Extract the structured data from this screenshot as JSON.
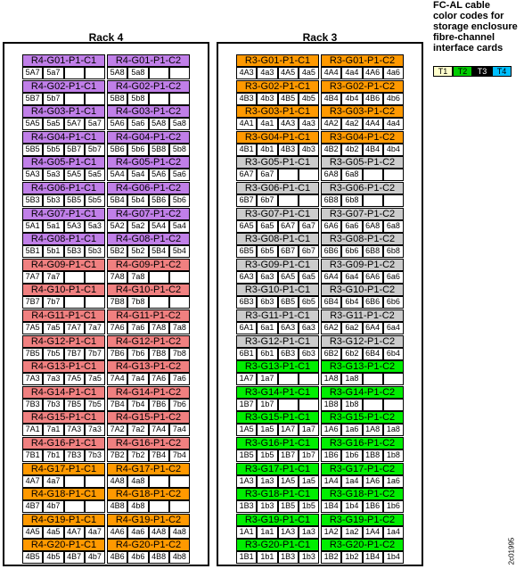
{
  "legend": {
    "title_lines": [
      "FC-AL cable",
      "color codes for",
      "storage enclosure",
      "fibre-channel",
      "interface cards"
    ],
    "items": [
      {
        "label": "T1",
        "color": "#ffffcc",
        "text_color": "#000000"
      },
      {
        "label": "T2",
        "color": "#00cc00",
        "text_color": "#000000"
      },
      {
        "label": "T3",
        "color": "#000000",
        "text_color": "#ffffff"
      },
      {
        "label": "T4",
        "color": "#00bfff",
        "text_color": "#000000"
      }
    ]
  },
  "figure_id": "2c01995",
  "racks": [
    {
      "title": "Rack 4",
      "slots": [
        {
          "c1": "R4-G01-P1-C1",
          "c2": "R4-G01-P1-C2",
          "color": "#c07fe8",
          "ports": [
            "5A7",
            "5a7",
            "",
            "",
            "5A8",
            "5a8",
            "",
            ""
          ]
        },
        {
          "c1": "R4-G02-P1-C1",
          "c2": "R4-G02-P1-C2",
          "color": "#c07fe8",
          "ports": [
            "5B7",
            "5b7",
            "",
            "",
            "5B8",
            "5b8",
            "",
            ""
          ]
        },
        {
          "c1": "R4-G03-P1-C1",
          "c2": "R4-G03-P1-C2",
          "color": "#c07fe8",
          "ports": [
            "5A5",
            "5a5",
            "5A7",
            "5a7",
            "5A6",
            "5a6",
            "5A8",
            "5a8"
          ]
        },
        {
          "c1": "R4-G04-P1-C1",
          "c2": "R4-G04-P1-C2",
          "color": "#c07fe8",
          "ports": [
            "5B5",
            "5b5",
            "5B7",
            "5b7",
            "5B6",
            "5b6",
            "5B8",
            "5b8"
          ]
        },
        {
          "c1": "R4-G05-P1-C1",
          "c2": "R4-G05-P1-C2",
          "color": "#c07fe8",
          "ports": [
            "5A3",
            "5a3",
            "5A5",
            "5a5",
            "5A4",
            "5a4",
            "5A6",
            "5a6"
          ]
        },
        {
          "c1": "R4-G06-P1-C1",
          "c2": "R4-G06-P1-C2",
          "color": "#c07fe8",
          "ports": [
            "5B3",
            "5b3",
            "5B5",
            "5b5",
            "5B4",
            "5b4",
            "5B6",
            "5b6"
          ]
        },
        {
          "c1": "R4-G07-P1-C1",
          "c2": "R4-G07-P1-C2",
          "color": "#c07fe8",
          "ports": [
            "5A1",
            "5a1",
            "5A3",
            "5a3",
            "5A2",
            "5a2",
            "5A4",
            "5a4"
          ]
        },
        {
          "c1": "R4-G08-P1-C1",
          "c2": "R4-G08-P1-C2",
          "color": "#c07fe8",
          "ports": [
            "5B1",
            "5b1",
            "5B3",
            "5b3",
            "5B2",
            "5b2",
            "5B4",
            "5b4"
          ]
        },
        {
          "c1": "R4-G09-P1-C1",
          "c2": "R4-G09-P1-C2",
          "color": "#f08080",
          "ports": [
            "7A7",
            "7a7",
            "",
            "",
            "7A8",
            "7a8",
            "",
            ""
          ]
        },
        {
          "c1": "R4-G10-P1-C1",
          "c2": "R4-G10-P1-C2",
          "color": "#f08080",
          "ports": [
            "7B7",
            "7b7",
            "",
            "",
            "7B8",
            "7b8",
            "",
            ""
          ]
        },
        {
          "c1": "R4-G11-P1-C1",
          "c2": "R4-G11-P1-C2",
          "color": "#f08080",
          "ports": [
            "7A5",
            "7a5",
            "7A7",
            "7a7",
            "7A6",
            "7a6",
            "7A8",
            "7a8"
          ]
        },
        {
          "c1": "R4-G12-P1-C1",
          "c2": "R4-G12-P1-C2",
          "color": "#f08080",
          "ports": [
            "7B5",
            "7b5",
            "7B7",
            "7b7",
            "7B6",
            "7b6",
            "7B8",
            "7b8"
          ]
        },
        {
          "c1": "R4-G13-P1-C1",
          "c2": "R4-G13-P1-C2",
          "color": "#f08080",
          "ports": [
            "7A3",
            "7a3",
            "7A5",
            "7a5",
            "7A4",
            "7a4",
            "7A6",
            "7a6"
          ]
        },
        {
          "c1": "R4-G14-P1-C1",
          "c2": "R4-G14-P1-C2",
          "color": "#f08080",
          "ports": [
            "7B3",
            "7b3",
            "7B5",
            "7b5",
            "7B4",
            "7b4",
            "7B6",
            "7b6"
          ]
        },
        {
          "c1": "R4-G15-P1-C1",
          "c2": "R4-G15-P1-C2",
          "color": "#f08080",
          "ports": [
            "7A1",
            "7a1",
            "7A3",
            "7a3",
            "7A2",
            "7a2",
            "7A4",
            "7a4"
          ]
        },
        {
          "c1": "R4-G16-P1-C1",
          "c2": "R4-G16-P1-C2",
          "color": "#f08080",
          "ports": [
            "7B1",
            "7b1",
            "7B3",
            "7b3",
            "7B2",
            "7b2",
            "7B4",
            "7b4"
          ]
        },
        {
          "c1": "R4-G17-P1-C1",
          "c2": "R4-G17-P1-C2",
          "color": "#ff9900",
          "ports": [
            "4A7",
            "4a7",
            "",
            "",
            "4A8",
            "4a8",
            "",
            ""
          ]
        },
        {
          "c1": "R4-G18-P1-C1",
          "c2": "R4-G18-P1-C2",
          "color": "#ff9900",
          "ports": [
            "4B7",
            "4b7",
            "",
            "",
            "4B8",
            "4b8",
            "",
            ""
          ]
        },
        {
          "c1": "R4-G19-P1-C1",
          "c2": "R4-G19-P1-C2",
          "color": "#ff9900",
          "ports": [
            "4A5",
            "4a5",
            "4A7",
            "4a7",
            "4A6",
            "4a6",
            "4A8",
            "4a8"
          ]
        },
        {
          "c1": "R4-G20-P1-C1",
          "c2": "R4-G20-P1-C2",
          "color": "#ff9900",
          "ports": [
            "4B5",
            "4b5",
            "4B7",
            "4b7",
            "4B6",
            "4b6",
            "4B8",
            "4b8"
          ]
        }
      ]
    },
    {
      "title": "Rack 3",
      "slots": [
        {
          "c1": "R3-G01-P1-C1",
          "c2": "R3-G01-P1-C2",
          "color": "#ff9900",
          "ports": [
            "4A3",
            "4a3",
            "4A5",
            "4a5",
            "4A4",
            "4a4",
            "4A6",
            "4a6"
          ]
        },
        {
          "c1": "R3-G02-P1-C1",
          "c2": "R3-G02-P1-C2",
          "color": "#ff9900",
          "ports": [
            "4B3",
            "4b3",
            "4B5",
            "4b5",
            "4B4",
            "4b4",
            "4B6",
            "4b6"
          ]
        },
        {
          "c1": "R3-G03-P1-C1",
          "c2": "R3-G03-P1-C2",
          "color": "#ff9900",
          "ports": [
            "4A1",
            "4a1",
            "4A3",
            "4a3",
            "4A2",
            "4a2",
            "4A4",
            "4a4"
          ]
        },
        {
          "c1": "R3-G04-P1-C1",
          "c2": "R3-G04-P1-C2",
          "color": "#ff9900",
          "ports": [
            "4B1",
            "4b1",
            "4B3",
            "4b3",
            "4B2",
            "4b2",
            "4B4",
            "4b4"
          ]
        },
        {
          "c1": "R3-G05-P1-C1",
          "c2": "R3-G05-P1-C2",
          "color": "#cccccc",
          "ports": [
            "6A7",
            "6a7",
            "",
            "",
            "6A8",
            "6a8",
            "",
            ""
          ]
        },
        {
          "c1": "R3-G06-P1-C1",
          "c2": "R3-G06-P1-C2",
          "color": "#cccccc",
          "ports": [
            "6B7",
            "6b7",
            "",
            "",
            "6B8",
            "6b8",
            "",
            ""
          ]
        },
        {
          "c1": "R3-G07-P1-C1",
          "c2": "R3-G07-P1-C2",
          "color": "#cccccc",
          "ports": [
            "6A5",
            "6a5",
            "6A7",
            "6a7",
            "6A6",
            "6a6",
            "6A8",
            "6a8"
          ]
        },
        {
          "c1": "R3-G08-P1-C1",
          "c2": "R3-G08-P1-C2",
          "color": "#cccccc",
          "ports": [
            "6B5",
            "6b5",
            "6B7",
            "6b7",
            "6B6",
            "6b6",
            "6B8",
            "6b8"
          ]
        },
        {
          "c1": "R3-G09-P1-C1",
          "c2": "R3-G09-P1-C2",
          "color": "#cccccc",
          "ports": [
            "6A3",
            "6a3",
            "6A5",
            "6a5",
            "6A4",
            "6a4",
            "6A6",
            "6a6"
          ]
        },
        {
          "c1": "R3-G10-P1-C1",
          "c2": "R3-G10-P1-C2",
          "color": "#cccccc",
          "ports": [
            "6B3",
            "6b3",
            "6B5",
            "6b5",
            "6B4",
            "6b4",
            "6B6",
            "6b6"
          ]
        },
        {
          "c1": "R3-G11-P1-C1",
          "c2": "R3-G11-P1-C2",
          "color": "#cccccc",
          "ports": [
            "6A1",
            "6a1",
            "6A3",
            "6a3",
            "6A2",
            "6a2",
            "6A4",
            "6a4"
          ]
        },
        {
          "c1": "R3-G12-P1-C1",
          "c2": "R3-G12-P1-C2",
          "color": "#cccccc",
          "ports": [
            "6B1",
            "6b1",
            "6B3",
            "6b3",
            "6B2",
            "6b2",
            "6B4",
            "6b4"
          ]
        },
        {
          "c1": "R3-G13-P1-C1",
          "c2": "R3-G13-P1-C2",
          "color": "#00ee00",
          "ports": [
            "1A7",
            "1a7",
            "",
            "",
            "1A8",
            "1a8",
            "",
            ""
          ]
        },
        {
          "c1": "R3-G14-P1-C1",
          "c2": "R3-G14-P1-C2",
          "color": "#00ee00",
          "ports": [
            "1B7",
            "1b7",
            "",
            "",
            "1B8",
            "1b8",
            "",
            ""
          ]
        },
        {
          "c1": "R3-G15-P1-C1",
          "c2": "R3-G15-P1-C2",
          "color": "#00ee00",
          "ports": [
            "1A5",
            "1a5",
            "1A7",
            "1a7",
            "1A6",
            "1a6",
            "1A8",
            "1a8"
          ]
        },
        {
          "c1": "R3-G16-P1-C1",
          "c2": "R3-G16-P1-C2",
          "color": "#00ee00",
          "ports": [
            "1B5",
            "1b5",
            "1B7",
            "1b7",
            "1B6",
            "1b6",
            "1B8",
            "1b8"
          ]
        },
        {
          "c1": "R3-G17-P1-C1",
          "c2": "R3-G17-P1-C2",
          "color": "#00ee00",
          "ports": [
            "1A3",
            "1a3",
            "1A5",
            "1a5",
            "1A4",
            "1a4",
            "1A6",
            "1a6"
          ]
        },
        {
          "c1": "R3-G18-P1-C1",
          "c2": "R3-G18-P1-C2",
          "color": "#00ee00",
          "ports": [
            "1B3",
            "1b3",
            "1B5",
            "1b5",
            "1B4",
            "1b4",
            "1B6",
            "1b6"
          ]
        },
        {
          "c1": "R3-G19-P1-C1",
          "c2": "R3-G19-P1-C2",
          "color": "#00ee00",
          "ports": [
            "1A1",
            "1a1",
            "1A3",
            "1a3",
            "1A2",
            "1a2",
            "1A4",
            "1a4"
          ]
        },
        {
          "c1": "R3-G20-P1-C1",
          "c2": "R3-G20-P1-C2",
          "color": "#00ee00",
          "ports": [
            "1B1",
            "1b1",
            "1B3",
            "1b3",
            "1B2",
            "1b2",
            "1B4",
            "1b4"
          ]
        }
      ]
    }
  ]
}
